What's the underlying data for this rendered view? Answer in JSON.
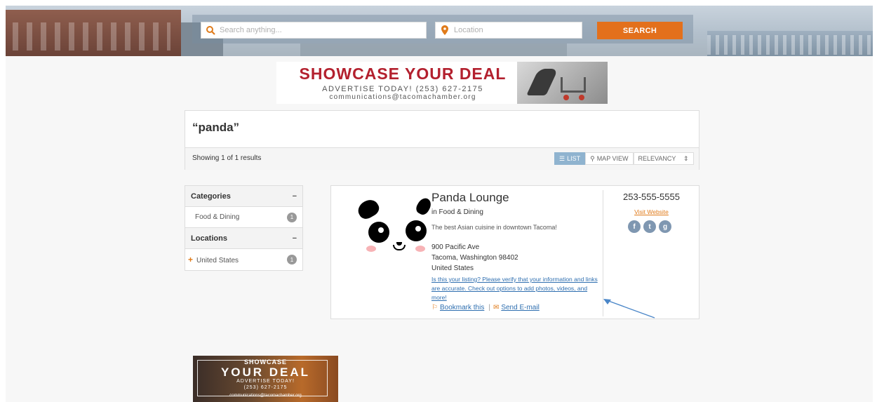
{
  "search": {
    "placeholder": "Search anything...",
    "location_placeholder": "Location",
    "button_label": "SEARCH"
  },
  "ad_top": {
    "headline": "SHOWCASE YOUR DEAL",
    "line1": "ADVERTISE TODAY! (253) 627-2175",
    "line2": "communications@tacomachamber.org"
  },
  "results": {
    "query": "“panda”",
    "count_text": "Showing 1 of 1 results",
    "view_list": "LIST",
    "view_map": "MAP VIEW",
    "sort_selected": "RELEVANCY"
  },
  "sidebar": {
    "categories_title": "Categories",
    "categories": [
      {
        "label": "Food & Dining",
        "count": "1"
      }
    ],
    "locations_title": "Locations",
    "locations": [
      {
        "label": "United States",
        "count": "1"
      }
    ]
  },
  "listing": {
    "name": "Panda Lounge",
    "category": "in Food & Dining",
    "description": "The best Asian cuisine in downtown Tacoma!",
    "address_line1": "900 Pacific Ave",
    "address_line2": "Tacoma, Washington 98402",
    "address_line3": "United States",
    "verify_text": "Is this your listing? Please verify that your information and links are accurate. Check out options to add photos, videos, and more!",
    "bookmark_label": "Bookmark this",
    "separator": "|",
    "email_label": "Send E-mail",
    "phone": "253-555-5555",
    "website_label": "Visit Website",
    "social": [
      "f",
      "t",
      "g"
    ]
  },
  "ad_bottom": {
    "line1": "SHOWCASE",
    "line2": "YOUR DEAL",
    "line3": "ADVERTISE TODAY!",
    "line4": "(253) 627-2175",
    "line5": "communications@tacomachamber.org"
  },
  "colors": {
    "accent": "#e3701c",
    "link": "#2f6fb0",
    "ad_red": "#b3202e",
    "list_active": "#8fb3cf"
  }
}
